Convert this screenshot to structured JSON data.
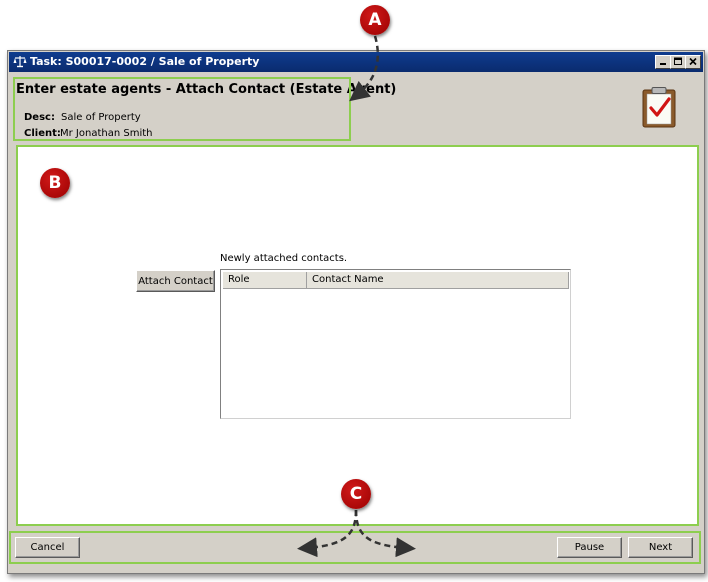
{
  "window": {
    "title": "Task: S00017-0002 / Sale of Property",
    "controls": [
      "minimize",
      "maximize",
      "close"
    ]
  },
  "header": {
    "heading": "Enter estate agents - Attach Contact (Estate Agent)",
    "desc_label": "Desc:",
    "desc_value": "Sale of Property",
    "client_label": "Client:",
    "client_value": "Mr Jonathan Smith",
    "icon": "clipboard-checkmark-icon"
  },
  "main": {
    "attach_button": "Attach Contact",
    "list_caption": "Newly attached contacts.",
    "columns": [
      "Role",
      "Contact Name"
    ],
    "rows": []
  },
  "footer": {
    "cancel_label": "Cancel",
    "pause_label": "Pause",
    "next_label": "Next"
  },
  "callouts": {
    "a": "A",
    "b": "B",
    "c": "C",
    "badge_color": "#b30000",
    "highlight_color": "#8dce4f"
  }
}
